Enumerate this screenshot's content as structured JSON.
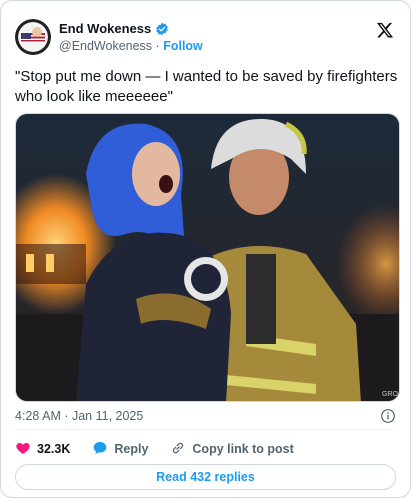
{
  "author": {
    "display_name": "End Wokeness",
    "handle": "@EndWokeness",
    "separator": "·",
    "follow_label": "Follow"
  },
  "tweet": {
    "text": "\"Stop put me down — I wanted to be saved by firefighters who look like meeeeee\"",
    "timestamp": "4:28 AM · Jan 11, 2025"
  },
  "media": {
    "watermark": "GROK ✦"
  },
  "actions": {
    "likes": "32.3K",
    "reply_label": "Reply",
    "copy_link_label": "Copy link to post"
  },
  "replies_button": "Read 432 replies",
  "colors": {
    "accent": "#1d9bf0",
    "like": "#f91880",
    "text": "#0f1419",
    "muted": "#536471"
  },
  "icons": [
    "verified-badge-icon",
    "x-logo-icon",
    "info-icon",
    "heart-icon",
    "reply-bubble-icon",
    "link-icon"
  ]
}
